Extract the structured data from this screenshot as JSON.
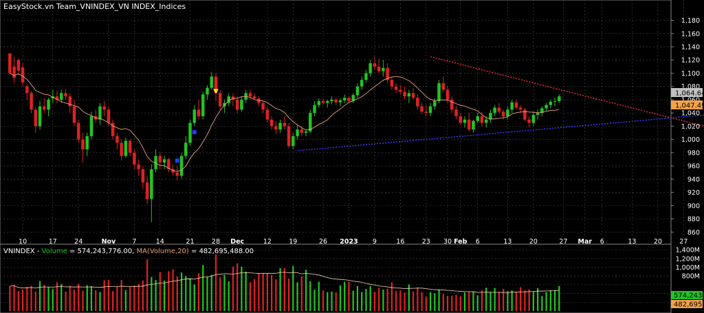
{
  "chart_data": {
    "type": "candlestick",
    "title": "EasyStock.vn Team_VNINDEX_VN INDEX_Indices",
    "price_axis": {
      "ticks": [
        860,
        880,
        900,
        920,
        940,
        960,
        980,
        1000,
        1020,
        1040,
        1060,
        1080,
        1100,
        1120,
        1140,
        1160,
        1180
      ],
      "tick_labels": [
        "860",
        "880",
        "900",
        "920",
        "940",
        "960",
        "980",
        "1,000",
        "1,020",
        "1,040",
        "1,060",
        "1,080",
        "1,100",
        "1,120",
        "1,140",
        "1,160",
        "1,180"
      ],
      "ylim": [
        852,
        1192
      ],
      "last_price_label": "1,064.64",
      "ma_label": "1,047.49"
    },
    "time_axis": {
      "labels": [
        "10",
        "17",
        "24",
        "Nov",
        "7",
        "14",
        "21",
        "28",
        "Dec",
        "12",
        "19",
        "26",
        "2023",
        "9",
        "16",
        "23",
        "30",
        "Feb",
        "6",
        "13",
        "20",
        "27",
        "Mar",
        "6",
        "13",
        "20",
        "27"
      ],
      "label_index": [
        4,
        11,
        17,
        24,
        30,
        36,
        43,
        49,
        54,
        61,
        67,
        74,
        80,
        86,
        92,
        98,
        103,
        106,
        110,
        117,
        123,
        130,
        135,
        139,
        146,
        152,
        158
      ]
    },
    "price_ohlc": {
      "start": 1,
      "ohlc": [
        [
          1130,
          1130,
          1100,
          1100
        ],
        [
          1110,
          1125,
          1085,
          1093
        ],
        [
          1120,
          1122,
          1098,
          1104
        ],
        [
          1109,
          1115,
          1080,
          1086
        ],
        [
          1080,
          1083,
          1060,
          1070
        ],
        [
          1070,
          1073,
          1040,
          1045
        ],
        [
          1045,
          1048,
          1010,
          1020
        ],
        [
          1020,
          1058,
          1015,
          1050
        ],
        [
          1050,
          1062,
          1040,
          1045
        ],
        [
          1045,
          1063,
          1035,
          1060
        ],
        [
          1062,
          1075,
          1055,
          1065
        ],
        [
          1065,
          1073,
          1055,
          1060
        ],
        [
          1060,
          1075,
          1055,
          1070
        ],
        [
          1070,
          1076,
          1060,
          1065
        ],
        [
          1065,
          1070,
          1040,
          1050
        ],
        [
          1050,
          1060,
          1020,
          1025
        ],
        [
          1025,
          1030,
          995,
          1000
        ],
        [
          1000,
          1010,
          965,
          985
        ],
        [
          985,
          1010,
          975,
          1005
        ],
        [
          1005,
          1042,
          1000,
          1035
        ],
        [
          1035,
          1045,
          1025,
          1030
        ],
        [
          1030,
          1055,
          1022,
          1050
        ],
        [
          1050,
          1058,
          1035,
          1045
        ],
        [
          1045,
          1050,
          1020,
          1025
        ],
        [
          1025,
          1030,
          1000,
          1005
        ],
        [
          1005,
          1010,
          985,
          995
        ],
        [
          995,
          1000,
          968,
          975
        ],
        [
          975,
          1003,
          972,
          998
        ],
        [
          998,
          1000,
          975,
          980
        ],
        [
          980,
          985,
          955,
          962
        ],
        [
          962,
          970,
          945,
          955
        ],
        [
          955,
          960,
          925,
          935
        ],
        [
          935,
          945,
          902,
          910
        ],
        [
          910,
          962,
          875,
          955
        ],
        [
          955,
          985,
          950,
          975
        ],
        [
          975,
          980,
          955,
          965
        ],
        [
          965,
          975,
          955,
          970
        ],
        [
          970,
          972,
          950,
          955
        ],
        [
          955,
          962,
          945,
          950
        ],
        [
          950,
          960,
          938,
          945
        ],
        [
          945,
          980,
          940,
          975
        ],
        [
          975,
          1005,
          970,
          995
        ],
        [
          995,
          1030,
          990,
          1025
        ],
        [
          1025,
          1052,
          1020,
          1045
        ],
        [
          1045,
          1060,
          1030,
          1035
        ],
        [
          1035,
          1072,
          1030,
          1068
        ],
        [
          1068,
          1082,
          1060,
          1078
        ],
        [
          1078,
          1102,
          1075,
          1095
        ],
        [
          1095,
          1100,
          1058,
          1070
        ],
        [
          1070,
          1075,
          1045,
          1050
        ],
        [
          1050,
          1060,
          1040,
          1055
        ],
        [
          1055,
          1070,
          1050,
          1065
        ],
        [
          1065,
          1070,
          1050,
          1060
        ],
        [
          1060,
          1065,
          1040,
          1045
        ],
        [
          1045,
          1065,
          1042,
          1060
        ],
        [
          1060,
          1075,
          1055,
          1070
        ],
        [
          1070,
          1075,
          1060,
          1065
        ],
        [
          1065,
          1070,
          1060,
          1062
        ],
        [
          1062,
          1065,
          1050,
          1055
        ],
        [
          1055,
          1058,
          1040,
          1045
        ],
        [
          1045,
          1050,
          1025,
          1030
        ],
        [
          1030,
          1035,
          1015,
          1020
        ],
        [
          1020,
          1028,
          1008,
          1015
        ],
        [
          1015,
          1030,
          1010,
          1025
        ],
        [
          1025,
          1035,
          1015,
          1020
        ],
        [
          1020,
          1025,
          987,
          990
        ],
        [
          990,
          1010,
          985,
          1005
        ],
        [
          1005,
          1022,
          1000,
          1015
        ],
        [
          1015,
          1020,
          1005,
          1010
        ],
        [
          1010,
          1015,
          1005,
          1012
        ],
        [
          1012,
          1045,
          1010,
          1040
        ],
        [
          1040,
          1058,
          1035,
          1052
        ],
        [
          1052,
          1062,
          1048,
          1058
        ],
        [
          1058,
          1062,
          1052,
          1055
        ],
        [
          1055,
          1060,
          1048,
          1058
        ],
        [
          1058,
          1065,
          1053,
          1060
        ],
        [
          1060,
          1063,
          1052,
          1056
        ],
        [
          1056,
          1062,
          1050,
          1059
        ],
        [
          1059,
          1068,
          1055,
          1063
        ],
        [
          1063,
          1065,
          1055,
          1058
        ],
        [
          1058,
          1070,
          1055,
          1067
        ],
        [
          1067,
          1085,
          1063,
          1080
        ],
        [
          1080,
          1095,
          1075,
          1090
        ],
        [
          1090,
          1105,
          1086,
          1100
        ],
        [
          1100,
          1120,
          1095,
          1115
        ],
        [
          1115,
          1125,
          1105,
          1110
        ],
        [
          1110,
          1122,
          1100,
          1103
        ],
        [
          1103,
          1120,
          1095,
          1108
        ],
        [
          1108,
          1115,
          1085,
          1090
        ],
        [
          1090,
          1095,
          1075,
          1080
        ],
        [
          1080,
          1085,
          1070,
          1075
        ],
        [
          1075,
          1082,
          1068,
          1072
        ],
        [
          1072,
          1080,
          1060,
          1065
        ],
        [
          1065,
          1075,
          1055,
          1070
        ],
        [
          1070,
          1078,
          1060,
          1063
        ],
        [
          1063,
          1068,
          1045,
          1050
        ],
        [
          1050,
          1055,
          1038,
          1042
        ],
        [
          1042,
          1052,
          1035,
          1040
        ],
        [
          1040,
          1055,
          1035,
          1050
        ],
        [
          1050,
          1062,
          1045,
          1058
        ],
        [
          1058,
          1090,
          1055,
          1085
        ],
        [
          1085,
          1095,
          1070,
          1075
        ],
        [
          1075,
          1080,
          1055,
          1060
        ],
        [
          1060,
          1065,
          1040,
          1045
        ],
        [
          1045,
          1050,
          1030,
          1035
        ],
        [
          1035,
          1040,
          1022,
          1025
        ],
        [
          1025,
          1035,
          1018,
          1030
        ],
        [
          1030,
          1040,
          1012,
          1015
        ],
        [
          1015,
          1030,
          1010,
          1028
        ],
        [
          1028,
          1040,
          1025,
          1035
        ],
        [
          1035,
          1042,
          1020,
          1025
        ],
        [
          1025,
          1035,
          1018,
          1030
        ],
        [
          1030,
          1045,
          1025,
          1040
        ],
        [
          1040,
          1052,
          1035,
          1048
        ],
        [
          1048,
          1055,
          1038,
          1042
        ],
        [
          1042,
          1045,
          1030,
          1035
        ],
        [
          1035,
          1050,
          1030,
          1045
        ],
        [
          1045,
          1060,
          1040,
          1056
        ],
        [
          1056,
          1060,
          1045,
          1048
        ],
        [
          1048,
          1052,
          1040,
          1045
        ],
        [
          1045,
          1048,
          1028,
          1030
        ],
        [
          1030,
          1035,
          1018,
          1025
        ],
        [
          1025,
          1040,
          1020,
          1037
        ],
        [
          1037,
          1045,
          1030,
          1040
        ],
        [
          1040,
          1050,
          1035,
          1047
        ],
        [
          1047,
          1055,
          1043,
          1052
        ],
        [
          1052,
          1060,
          1047,
          1057
        ],
        [
          1057,
          1063,
          1050,
          1058
        ],
        [
          1058,
          1068,
          1055,
          1065
        ]
      ]
    },
    "ma_overlay_label": "MA",
    "trendlines": [
      {
        "name": "resistance",
        "color": "#e03030",
        "from": {
          "bar": 99,
          "price": 1125
        },
        "to": {
          "bar": 170,
          "price": 1008
        }
      },
      {
        "name": "support",
        "color": "#3a3aff",
        "from": {
          "bar": 68,
          "price": 983
        },
        "to": {
          "bar": 170,
          "price": 1041
        }
      }
    ],
    "signals": [
      {
        "bar": 49,
        "price": 1072,
        "shape": "triangle-down",
        "color": "#f5e51b"
      },
      {
        "bar": 40,
        "price": 968,
        "shape": "square",
        "color": "#1e3cff"
      },
      {
        "bar": 44,
        "price": 1011,
        "shape": "square",
        "color": "#1e3cff"
      }
    ],
    "volume_panel": {
      "title_prefix": "VNINDEX",
      "volume_label": "Volume",
      "volume_value": "= 574,243,776.00,",
      "ma_label": "MA(Volume,20)",
      "ma_value": "= 482,695,488.00",
      "ticks": [
        200000000,
        400000000,
        600000000,
        800000000,
        1000000000,
        1200000000,
        1400000000
      ],
      "tick_labels": [
        "",
        "",
        "",
        "800M",
        "1,000M",
        "1,200M",
        "1,400M"
      ],
      "ylim": [
        0,
        1450000000
      ],
      "last_volume_label": "574,243,",
      "ma_volume_label": "482,695,"
    },
    "colors": {
      "up": "#22c422",
      "down": "#dd2222",
      "ma": "#e8a37a",
      "vol_ma": "#ffd8b0",
      "grid": "#444444"
    }
  }
}
